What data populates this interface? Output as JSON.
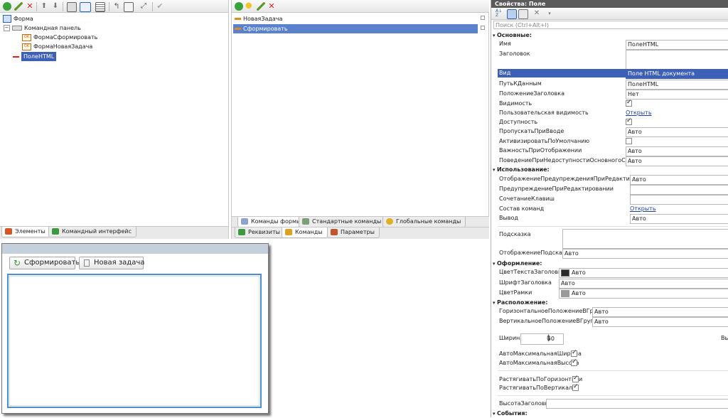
{
  "elements_tree": {
    "items": [
      {
        "label": "Форма"
      },
      {
        "label": "Командная панель"
      },
      {
        "label": "ФормаСформировать"
      },
      {
        "label": "ФормаНоваяЗадача"
      },
      {
        "label": "ПолеHTML"
      }
    ],
    "tabs": [
      {
        "label": "Элементы"
      },
      {
        "label": "Командный интерфейс"
      }
    ]
  },
  "commands_list": {
    "items": [
      {
        "label": "НоваяЗадача"
      },
      {
        "label": "Сформировать"
      }
    ],
    "tabs_row1": [
      {
        "label": "Команды формы"
      },
      {
        "label": "Стандартные команды"
      },
      {
        "label": "Глобальные команды"
      }
    ],
    "tabs_row2": [
      {
        "label": "Реквизиты"
      },
      {
        "label": "Команды"
      },
      {
        "label": "Параметры"
      }
    ]
  },
  "preview": {
    "buttons": [
      {
        "label": "Сформировать"
      },
      {
        "label": "Новая задача"
      }
    ]
  },
  "properties": {
    "title": "Свойства: Поле",
    "search_placeholder": "Поиск (Ctrl+Alt+I)",
    "sections": {
      "main": "Основные:",
      "usage": "Использование:",
      "appearance": "Оформление:",
      "layout": "Расположение:",
      "events": "События:"
    },
    "rows": {
      "name": {
        "label": "Имя",
        "value": "ПолеHTML"
      },
      "title": {
        "label": "Заголовок",
        "value": ""
      },
      "kind": {
        "label": "Вид",
        "value": "Поле HTML документа"
      },
      "datapath": {
        "label": "ПутьКДанным",
        "value": "ПолеHTML"
      },
      "title_pos": {
        "label": "ПоложениеЗаголовка",
        "value": "Нет"
      },
      "visible": {
        "label": "Видимость",
        "checked": true
      },
      "user_vis": {
        "label": "Пользовательская видимость",
        "link": "Открыть"
      },
      "enabled": {
        "label": "Доступность",
        "checked": true
      },
      "skip": {
        "label": "ПропускатьПриВводе",
        "value": "Авто"
      },
      "activate": {
        "label": "АктивизироватьПоУмолчанию",
        "checked": false
      },
      "importance": {
        "label": "ВажностьПриОтображении",
        "value": "Авто"
      },
      "behavior": {
        "label": "ПоведениеПриНедоступностиОсновногоСервера",
        "value": "Авто"
      },
      "edit_warn_disp": {
        "label": "ОтображениеПредупрежденияПриРедактировании",
        "value": "Авто"
      },
      "edit_warn": {
        "label": "ПредупреждениеПриРедактировании",
        "value": ""
      },
      "shortcut": {
        "label": "СочетаниеКлавиш",
        "value": ""
      },
      "cmd_set": {
        "label": "Состав команд",
        "link": "Открыть"
      },
      "output": {
        "label": "Вывод",
        "value": "Авто"
      },
      "hint": {
        "label": "Подсказка",
        "value": ""
      },
      "hint_disp": {
        "label": "ОтображениеПодсказки",
        "value": "Авто"
      },
      "title_color": {
        "label": "ЦветТекстаЗаголовка",
        "value": "Авто",
        "swatch": "#2a2a2a"
      },
      "title_font": {
        "label": "ШрифтЗаголовка",
        "value": "Авто"
      },
      "border_color": {
        "label": "ЦветРамки",
        "value": "Авто",
        "swatch": "#9a9a9a"
      },
      "h_pos": {
        "label": "ГоризонтальноеПоложениеВГруппе",
        "value": "Авто"
      },
      "v_pos": {
        "label": "ВертикальноеПоложениеВГруппе",
        "value": "Авто"
      },
      "width": {
        "label": "Ширина",
        "value": "50",
        "cut": "Вы"
      },
      "auto_max_w": {
        "label": "АвтоМаксимальнаяШирина",
        "checked": true
      },
      "auto_max_h": {
        "label": "АвтоМаксимальнаяВысота",
        "checked": true
      },
      "stretch_h": {
        "label": "РастягиватьПоГоризонтали",
        "checked": true
      },
      "stretch_v": {
        "label": "РастягиватьПоВертикали",
        "checked": true
      },
      "title_height": {
        "label": "ВысотаЗаголовка",
        "value": ""
      }
    }
  },
  "colors": {
    "selection": "#3d5fb6",
    "title_bar": "#5a5a5a",
    "preview_header": "#c4d0dc",
    "field_border": "#4a8fd4"
  }
}
